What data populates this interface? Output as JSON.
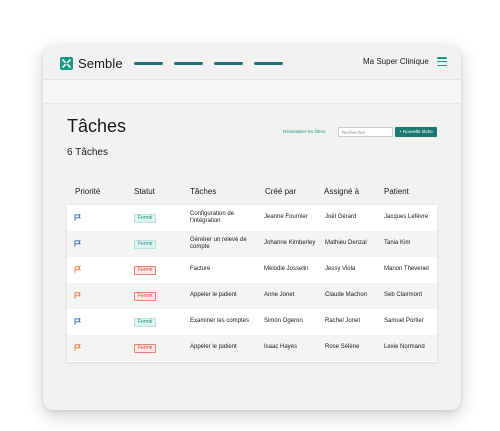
{
  "app": {
    "name": "Semble",
    "clinic": "Ma Super Clinique"
  },
  "colors": {
    "brand": "#159a86",
    "nav_line": "#1f6f78",
    "flag_blue": "#2f67a6",
    "flag_orange": "#e9713a",
    "status_done": "#1f8f7b",
    "status_late": "#d44838"
  },
  "page": {
    "title": "Tâches",
    "count": "6 Tâches",
    "reset_filters": "Réinitialiser les filtres",
    "search_placeholder": "Rechercher",
    "new_task": "+ Nouvelle tâche"
  },
  "table": {
    "headers": [
      "Priorité",
      "Statut",
      "Tâches",
      "Créé par",
      "Assigné à",
      "Patient"
    ],
    "rows": [
      {
        "priority": "blue",
        "priority_icon": "flag-icon",
        "status": "Fermé",
        "status_type": "done",
        "task": "Configuration de l'intégration",
        "created_by": "Jeanne Fournier",
        "assigned_to": "Joël Gérard",
        "patient": "Jacques Lefèvre"
      },
      {
        "priority": "blue",
        "priority_icon": "flag-icon",
        "status": "Fermé",
        "status_type": "done",
        "task": "Générer un relevé de compte",
        "created_by": "Johanne Kimberley",
        "assigned_to": "Mathieu Denzal",
        "patient": "Tania Kim"
      },
      {
        "priority": "orange",
        "priority_icon": "flag-icon",
        "status": "Fermé",
        "status_type": "late",
        "task": "Facture",
        "created_by": "Mélodie Josselin",
        "assigned_to": "Jessy Viola",
        "patient": "Manon Thévenet"
      },
      {
        "priority": "orange",
        "priority_icon": "flag-icon",
        "status": "Fermé",
        "status_type": "late",
        "task": "Appeler le patient",
        "created_by": "Anne Jonet",
        "assigned_to": "Claude Machon",
        "patient": "Seb Clairmont"
      },
      {
        "priority": "blue",
        "priority_icon": "flag-icon",
        "status": "Fermé",
        "status_type": "done",
        "task": "Examiner les comptes",
        "created_by": "Simon Ogeron",
        "assigned_to": "Rachel Jonet",
        "patient": "Samuel Portier"
      },
      {
        "priority": "orange",
        "priority_icon": "flag-icon",
        "status": "Fermé",
        "status_type": "late",
        "task": "Appeler le patient",
        "created_by": "Isaac Hayes",
        "assigned_to": "Rose Sélène",
        "patient": "Lexie Normand"
      }
    ]
  }
}
